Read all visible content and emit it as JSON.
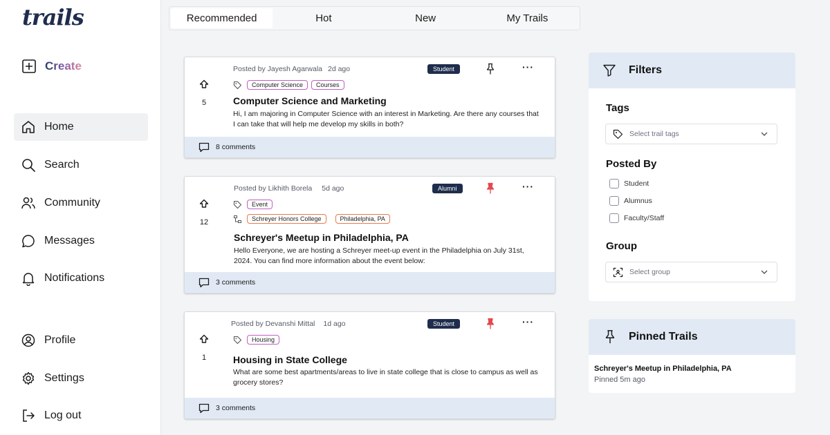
{
  "app": {
    "logo": "trails"
  },
  "sidebar": {
    "create_label": "Create",
    "items": [
      {
        "label": "Home",
        "icon": "home-icon",
        "active": true
      },
      {
        "label": "Search",
        "icon": "search-icon"
      },
      {
        "label": "Community",
        "icon": "community-icon"
      },
      {
        "label": "Messages",
        "icon": "message-icon"
      },
      {
        "label": "Notifications",
        "icon": "bell-icon"
      },
      {
        "label": "Profile",
        "icon": "profile-icon"
      },
      {
        "label": "Settings",
        "icon": "gear-icon"
      },
      {
        "label": "Log out",
        "icon": "logout-icon"
      }
    ]
  },
  "tabs": [
    {
      "label": "Recommended",
      "active": true
    },
    {
      "label": "Hot"
    },
    {
      "label": "New"
    },
    {
      "label": "My Trails"
    }
  ],
  "posts": [
    {
      "posted_by": "Posted by Jayesh Agarwala",
      "ago": "2d ago",
      "role": "Student",
      "pinned": false,
      "votes": "5",
      "tags": [
        "Computer Science",
        "Courses"
      ],
      "groups": [],
      "title": "Computer Science and Marketing",
      "body": "Hi, I am majoring in Computer Science with an interest in Marketing. Are there any courses that I can take that will help me develop my skills in both?",
      "comments": "8 comments"
    },
    {
      "posted_by": "Posted by Likhith Borela",
      "ago": "5d ago",
      "role": "Alumni",
      "pinned": true,
      "votes": "12",
      "tags": [
        "Event"
      ],
      "groups": [
        "Schreyer Honors College",
        "Philadelphia, PA"
      ],
      "title": "Schreyer's Meetup in Philadelphia, PA",
      "body": "Hello Everyone, we are hosting a Schreyer meet-up event in the Philadelphia on July 31st, 2024. You can find more information about the event below:",
      "comments": "3 comments"
    },
    {
      "posted_by": "Posted by Devanshi Mittal",
      "ago": "1d ago",
      "role": "Student",
      "pinned": true,
      "votes": "1",
      "tags": [
        "Housing"
      ],
      "groups": [],
      "title": "Housing in State College",
      "body": "What are some best apartments/areas to live in state college that is close to campus as well as grocery stores?",
      "comments": "3 comments"
    }
  ],
  "filters": {
    "title": "Filters",
    "tags_title": "Tags",
    "tags_placeholder": "Select trail tags",
    "posted_by_title": "Posted By",
    "posted_by_options": [
      "Student",
      "Alumnus",
      "Faculty/Staff"
    ],
    "group_title": "Group",
    "group_placeholder": "Select group"
  },
  "pinned": {
    "title": "Pinned Trails",
    "item_title": "Schreyer's Meetup in Philadelphia, PA",
    "item_time": "Pinned 5m ago"
  },
  "colors": {
    "navy": "#1f2d4d",
    "light_blue": "#e1eaf4",
    "pin_red": "#e5484d",
    "tag_purple": "#c05ec4",
    "tag_orange": "#e57a4c"
  }
}
